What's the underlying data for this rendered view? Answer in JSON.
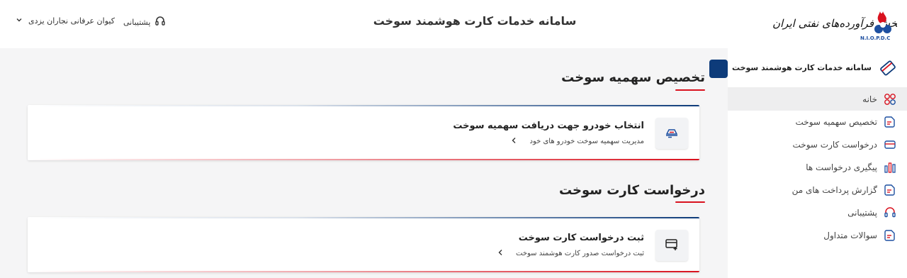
{
  "header": {
    "title": "سامانه خدمات کارت هوشمند سوخت",
    "user_name": "کیوان عرفانی نجاران یزدی",
    "support_label": "پشتیبانی",
    "logo_text": "شرکت ملی پخش فرآورده‌های نفتی ایران",
    "logo_abbr": "N.I.O.P.D.C"
  },
  "sidebar": {
    "title": "سامانه خدمات کارت هوشمند سوخت",
    "items": [
      {
        "label": "خانه",
        "icon": "home-grid-icon",
        "active": true
      },
      {
        "label": "تخصیص سهمیه سوخت",
        "icon": "document-icon"
      },
      {
        "label": "درخواست کارت سوخت",
        "icon": "card-icon"
      },
      {
        "label": "پیگیری درخواست ها",
        "icon": "bar-chart-icon"
      },
      {
        "label": "گزارش پرداخت های من",
        "icon": "document-icon"
      },
      {
        "label": "پشتیبانی",
        "icon": "headset-icon"
      },
      {
        "label": "سوالات متداول",
        "icon": "document-icon"
      }
    ]
  },
  "sections": [
    {
      "title": "تخصیص سهمیه سوخت",
      "card": {
        "title": "انتخاب خودرو جهت دریافت سهمیه سوخت",
        "subtitle": "مدیریت سهمیه سوخت خودرو های خود",
        "icon": "car-fuel-icon"
      }
    },
    {
      "title": "درخواست کارت سوخت",
      "card": {
        "title": "ثبت درخواست کارت سوخت",
        "subtitle": "ثبت درخواست صدور کارت هوشمند سوخت",
        "icon": "add-card-icon"
      }
    }
  ],
  "colors": {
    "primary": "#0d3b7a",
    "accent": "#d9121f",
    "background": "#f5f5f6"
  }
}
